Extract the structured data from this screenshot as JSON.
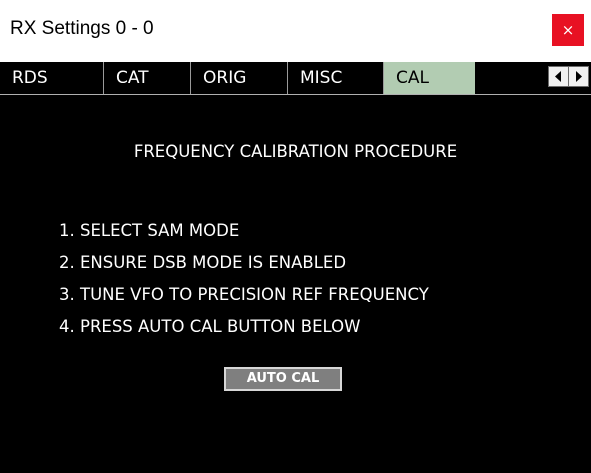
{
  "window": {
    "title": "RX Settings 0 - 0",
    "close_glyph": "×",
    "close_icon": "close-icon",
    "close_color": "#e81123"
  },
  "tabs": {
    "items": [
      {
        "label": "RDS",
        "active": false
      },
      {
        "label": "CAT",
        "active": false
      },
      {
        "label": "ORIG",
        "active": false
      },
      {
        "label": "MISC",
        "active": false
      },
      {
        "label": "CAL",
        "active": true
      }
    ],
    "active_tab_color": "#b2ccb2",
    "scroll_left_icon": "arrow-left-icon",
    "scroll_right_icon": "arrow-right-icon"
  },
  "cal_panel": {
    "heading": "FREQUENCY CALIBRATION PROCEDURE",
    "steps": [
      "1. SELECT SAM MODE",
      "2. ENSURE DSB MODE IS ENABLED",
      "3. TUNE VFO TO PRECISION REF FREQUENCY",
      "4. PRESS AUTO CAL BUTTON BELOW"
    ],
    "auto_cal_label": "AUTO CAL",
    "background_color": "#000000",
    "text_color": "#ffffff"
  }
}
